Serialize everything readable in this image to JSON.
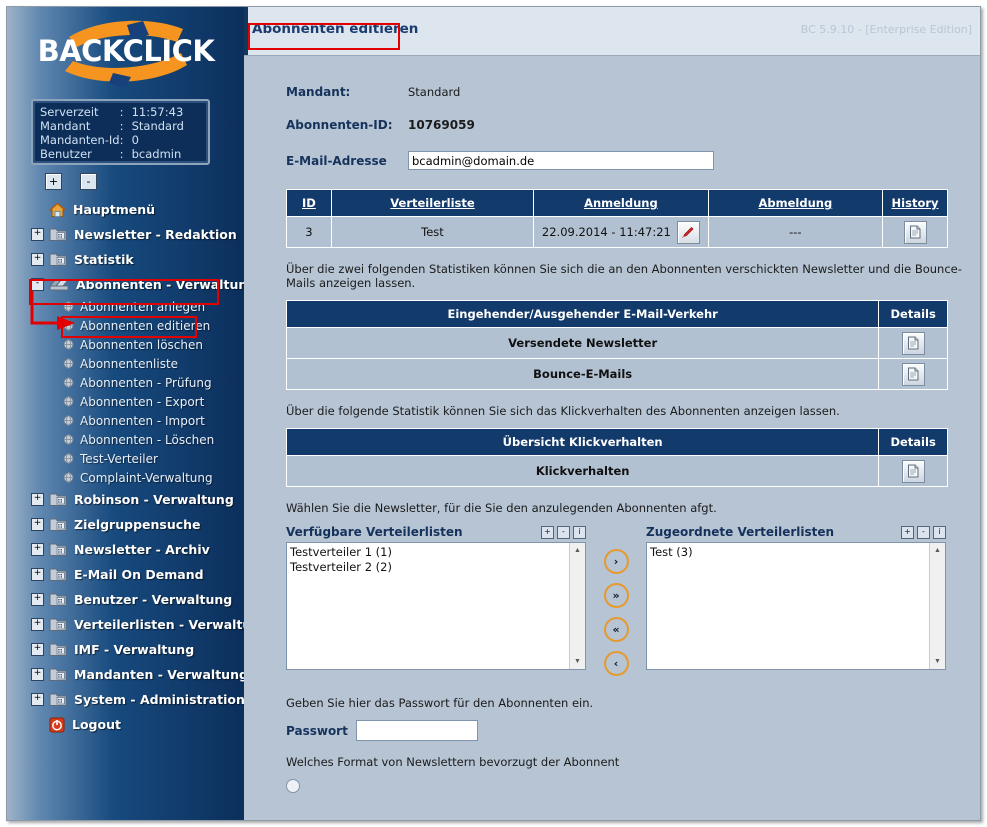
{
  "app": {
    "logo_text": "BACKCLICK",
    "version_label": "BC 5.9.10 - [Enterprise Edition]",
    "page_title": "Abonnenten editieren"
  },
  "colors": {
    "sidebar_dark": "#0c2f5c",
    "table_header": "#123a6b",
    "accent_orange": "#f5941f",
    "annotation_red": "#e20000",
    "content_bg": "#b6c4d4"
  },
  "server_info": {
    "rows": [
      {
        "key": "Serverzeit",
        "sep": ":",
        "value": "11:57:43"
      },
      {
        "key": "Mandant",
        "sep": ":",
        "value": "Standard"
      },
      {
        "key": "Mandanten-Id",
        "sep": ":",
        "value": "0"
      },
      {
        "key": "Benutzer",
        "sep": ":",
        "value": "bcadmin"
      }
    ]
  },
  "tree_controls": {
    "expand_all": "+",
    "collapse_all": "-"
  },
  "sidebar": {
    "items": [
      {
        "label": "Hauptmenü",
        "expander": "",
        "icon": "home-icon"
      },
      {
        "label": "Newsletter - Redaktion",
        "expander": "+",
        "icon": "folder-icon"
      },
      {
        "label": "Statistik",
        "expander": "+",
        "icon": "folder-icon"
      },
      {
        "label": "Abonnenten - Verwaltung",
        "expander": "-",
        "icon": "subscribers-icon"
      },
      {
        "label": "Robinson - Verwaltung",
        "expander": "+",
        "icon": "folder-icon"
      },
      {
        "label": "Zielgruppensuche",
        "expander": "+",
        "icon": "folder-icon"
      },
      {
        "label": "Newsletter - Archiv",
        "expander": "+",
        "icon": "folder-icon"
      },
      {
        "label": "E-Mail On Demand",
        "expander": "+",
        "icon": "folder-icon"
      },
      {
        "label": "Benutzer - Verwaltung",
        "expander": "+",
        "icon": "folder-icon"
      },
      {
        "label": "Verteilerlisten - Verwaltung",
        "expander": "+",
        "icon": "folder-icon"
      },
      {
        "label": "IMF - Verwaltung",
        "expander": "+",
        "icon": "folder-icon"
      },
      {
        "label": "Mandanten - Verwaltung",
        "expander": "+",
        "icon": "folder-icon"
      },
      {
        "label": "System - Administration",
        "expander": "+",
        "icon": "folder-icon"
      },
      {
        "label": "Logout",
        "expander": "",
        "icon": "logout-icon"
      }
    ],
    "subitems": [
      {
        "label": "Abonnenten anlegen"
      },
      {
        "label": "Abonnenten editieren"
      },
      {
        "label": "Abonnenten löschen"
      },
      {
        "label": "Abonnentenliste"
      },
      {
        "label": "Abonnenten - Prüfung"
      },
      {
        "label": "Abonnenten - Export"
      },
      {
        "label": "Abonnenten - Import"
      },
      {
        "label": "Abonnenten - Löschen"
      },
      {
        "label": "Test-Verteiler"
      },
      {
        "label": "Complaint-Verwaltung"
      }
    ]
  },
  "form": {
    "mandant_label": "Mandant:",
    "mandant_value": "Standard",
    "abo_id_label": "Abonnenten-ID:",
    "abo_id_value": "10769059",
    "email_label": "E-Mail-Adresse",
    "email_value": "bcadmin@domain.de"
  },
  "subscription_table": {
    "headers": [
      "ID",
      "Verteilerliste",
      "Anmeldung",
      "Abmeldung",
      "History"
    ],
    "rows": [
      {
        "id": "3",
        "verteilerliste": "Test",
        "anmeldung": "22.09.2014 - 11:47:21",
        "anmeldung_icon": "pencil-icon",
        "abmeldung": "---",
        "history_icon": "document-icon"
      }
    ]
  },
  "traffic_section": {
    "intro": "Über die zwei folgenden Statistiken können Sie sich die an den Abonnenten verschickten Newsletter und die Bounce-Mails anzeigen lassen.",
    "header": "Eingehender/Ausgehender E-Mail-Verkehr",
    "details_header": "Details",
    "rows": [
      {
        "label": "Versendete Newsletter",
        "icon": "document-icon"
      },
      {
        "label": "Bounce-E-Mails",
        "icon": "document-icon"
      }
    ]
  },
  "click_section": {
    "intro": "Über die folgende Statistik können Sie sich das Klickverhalten des Abonnenten anzeigen lassen.",
    "header": "Übersicht Klickverhalten",
    "details_header": "Details",
    "rows": [
      {
        "label": "Klickverhalten",
        "icon": "document-icon"
      }
    ]
  },
  "lists_section": {
    "intro": "Wählen Sie die Newsletter, für die Sie den anzulegenden Abonnenten afgt.",
    "available": {
      "title": "Verfügbare Verteilerlisten",
      "controls": [
        "+",
        "-",
        "i"
      ],
      "options": [
        "Testverteiler 1 (1)",
        "Testverteiler 2 (2)"
      ]
    },
    "assigned": {
      "title": "Zugeordnete Verteilerlisten",
      "controls": [
        "+",
        "-",
        "i"
      ],
      "options": [
        "Test (3)"
      ]
    },
    "transfer_buttons": [
      {
        "glyph": "›",
        "name": "move-right-button"
      },
      {
        "glyph": "»",
        "name": "move-all-right-button"
      },
      {
        "glyph": "«",
        "name": "move-all-left-button"
      },
      {
        "glyph": "‹",
        "name": "move-left-button"
      }
    ]
  },
  "password_section": {
    "intro": "Geben Sie hier das Passwort für den Abonnenten ein.",
    "label": "Passwort",
    "value": "",
    "placeholder": ""
  },
  "format_section": {
    "intro": "Welches Format von Newslettern bevorzugt der Abonnent"
  }
}
